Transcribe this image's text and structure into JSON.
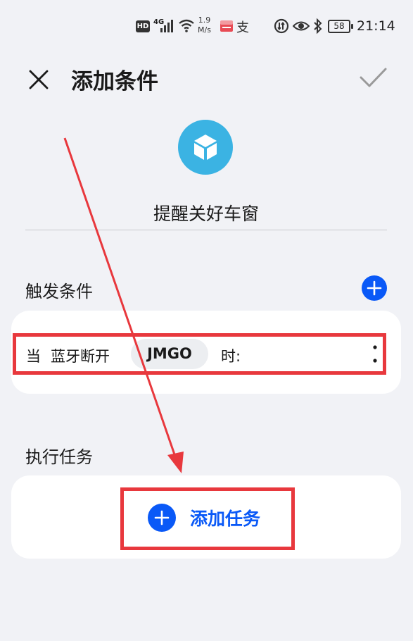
{
  "status_bar": {
    "hd_label": "HD",
    "network_label": "4G",
    "speed_value": "1.9",
    "speed_unit": "M/s",
    "app_icon_2_glyph": "支",
    "battery_level": "58",
    "time": "21:14"
  },
  "header": {
    "title": "添加条件",
    "close_icon": "close-icon",
    "confirm_icon": "check-icon"
  },
  "scene": {
    "name": "提醒关好车窗",
    "icon": "cube-icon",
    "icon_color": "#3bb3e3"
  },
  "trigger_section": {
    "label": "触发条件",
    "add_icon": "plus-icon",
    "condition": {
      "prefix": "当",
      "event": "蓝牙断开",
      "device": "JMGO",
      "suffix": "时:"
    }
  },
  "task_section": {
    "label": "执行任务",
    "add_task_label": "添加任务"
  },
  "colors": {
    "accent": "#0a59f7",
    "highlight": "#e8383d",
    "background": "#f1f2f6"
  }
}
